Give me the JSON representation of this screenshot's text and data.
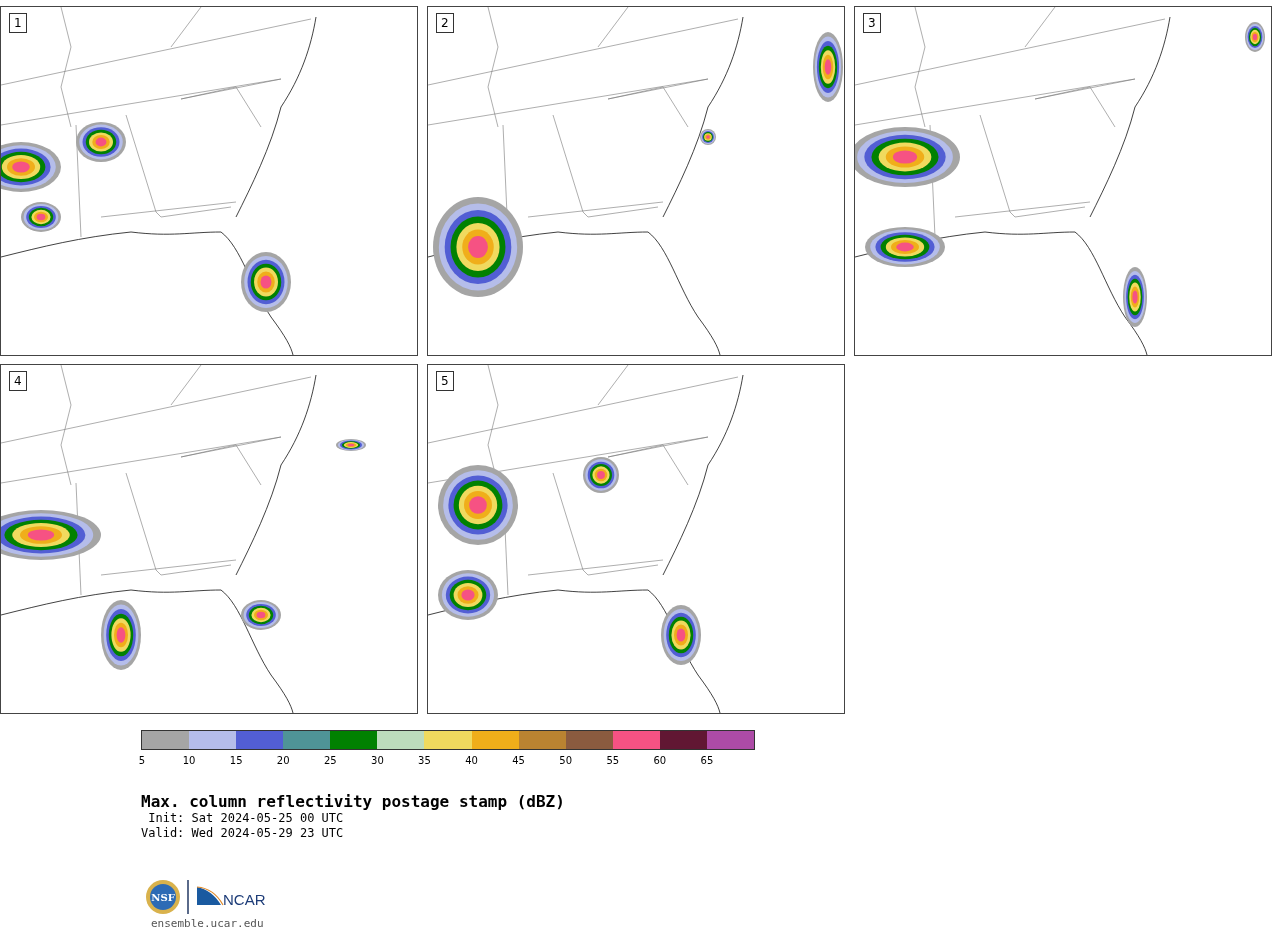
{
  "panels": [
    {
      "label": "1"
    },
    {
      "label": "2"
    },
    {
      "label": "3"
    },
    {
      "label": "4"
    },
    {
      "label": "5"
    }
  ],
  "colorbar": {
    "segments": [
      {
        "color": "#a5a5a5",
        "tick": "5"
      },
      {
        "color": "#b5bdea",
        "tick": "10"
      },
      {
        "color": "#525ed4",
        "tick": "15"
      },
      {
        "color": "#4f9497",
        "tick": "20"
      },
      {
        "color": "#018101",
        "tick": "25"
      },
      {
        "color": "#bddcbc",
        "tick": "30"
      },
      {
        "color": "#f0da5e",
        "tick": "35"
      },
      {
        "color": "#f0ae1a",
        "tick": "40"
      },
      {
        "color": "#ba8331",
        "tick": "45"
      },
      {
        "color": "#8b5b3f",
        "tick": "50"
      },
      {
        "color": "#f65283",
        "tick": "55"
      },
      {
        "color": "#611733",
        "tick": "60"
      },
      {
        "color": "#ad4ba7",
        "tick": "65"
      }
    ]
  },
  "title": "Max. column reflectivity postage stamp (dBZ)",
  "init": " Init: Sat 2024-05-25 00 UTC",
  "valid": "Valid: Wed 2024-05-29 23 UTC",
  "logos": {
    "nsf": "NSF",
    "ncar": "NCAR"
  },
  "site": "ensemble.ucar.edu"
}
